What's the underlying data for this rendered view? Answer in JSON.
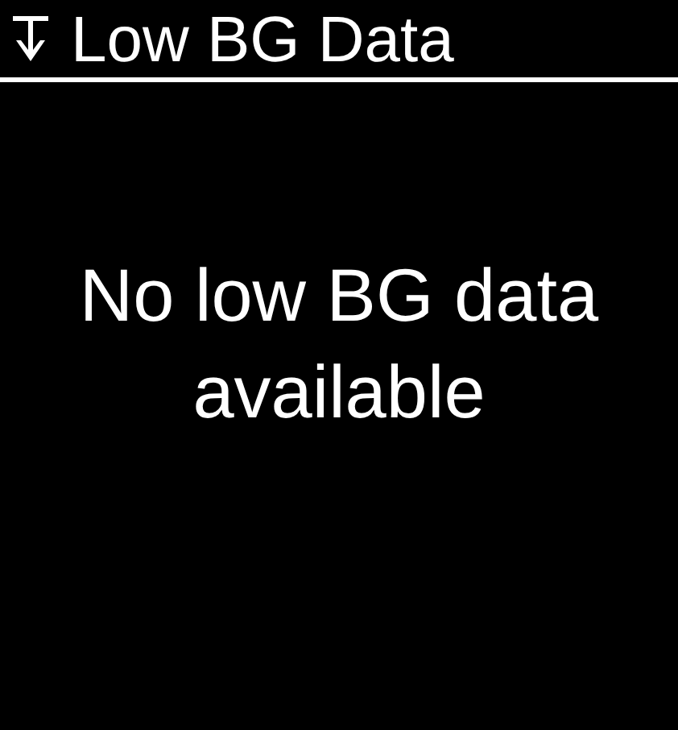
{
  "header": {
    "title": "Low BG Data"
  },
  "message": "No low BG data available"
}
